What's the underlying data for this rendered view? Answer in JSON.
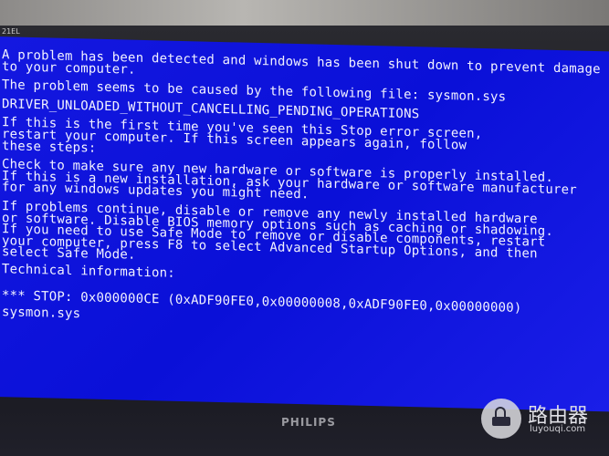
{
  "monitor": {
    "model_label": "21EL",
    "brand": "PHILIPS"
  },
  "bsod": {
    "background_color": "#0c12dc",
    "text_color": "#f2f2ff",
    "paragraphs": [
      "A problem has been detected and windows has been shut down to prevent damage\nto your computer.",
      "The problem seems to be caused by the following file: sysmon.sys",
      "DRIVER_UNLOADED_WITHOUT_CANCELLING_PENDING_OPERATIONS",
      "If this is the first time you've seen this Stop error screen,\nrestart your computer. If this screen appears again, follow\nthese steps:",
      "Check to make sure any new hardware or software is properly installed.\nIf this is a new installation, ask your hardware or software manufacturer\nfor any windows updates you might need.",
      "If problems continue, disable or remove any newly installed hardware\nor software. Disable BIOS memory options such as caching or shadowing.\nIf you need to use Safe Mode to remove or disable components, restart\nyour computer, press F8 to select Advanced Startup Options, and then\nselect Safe Mode.",
      "Technical information:",
      "*** STOP: 0x000000CE (0xADF90FE0,0x00000008,0xADF90FE0,0x00000000)",
      "sysmon.sys"
    ]
  },
  "watermark": {
    "icon": "router-icon",
    "title": "路由器",
    "url": "luyouqi.com"
  }
}
